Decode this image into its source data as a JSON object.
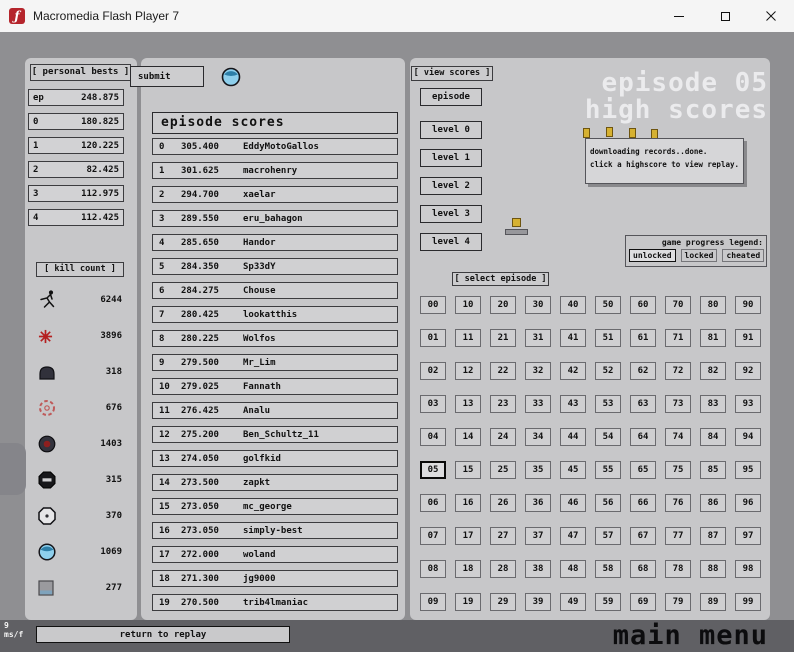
{
  "window": {
    "title": "Macromedia Flash Player 7"
  },
  "personal_bests": {
    "label": "[ personal bests ]",
    "submit_label": "submit",
    "rows": [
      {
        "key": "ep",
        "value": "248.875"
      },
      {
        "key": "0",
        "value": "180.825"
      },
      {
        "key": "1",
        "value": "120.225"
      },
      {
        "key": "2",
        "value": "82.425"
      },
      {
        "key": "3",
        "value": "112.975"
      },
      {
        "key": "4",
        "value": "112.425"
      }
    ]
  },
  "kill_count": {
    "label": "[ kill count ]",
    "rows": [
      {
        "enemy": "ninja",
        "value": "6244"
      },
      {
        "enemy": "mine",
        "value": "3896"
      },
      {
        "enemy": "turret",
        "value": "318"
      },
      {
        "enemy": "rocket-turret",
        "value": "676"
      },
      {
        "enemy": "gauss-turret",
        "value": "1403"
      },
      {
        "enemy": "zap-drone",
        "value": "315"
      },
      {
        "enemy": "seeker-drone",
        "value": "370"
      },
      {
        "enemy": "floatguard",
        "value": "1069"
      },
      {
        "enemy": "thwump",
        "value": "277"
      }
    ]
  },
  "episode_scores": {
    "title": "episode scores",
    "rows": [
      {
        "rank": "0",
        "score": "305.400",
        "name": "EddyMotoGallos"
      },
      {
        "rank": "1",
        "score": "301.625",
        "name": "macrohenry"
      },
      {
        "rank": "2",
        "score": "294.700",
        "name": "xaelar"
      },
      {
        "rank": "3",
        "score": "289.550",
        "name": "eru_bahagon"
      },
      {
        "rank": "4",
        "score": "285.650",
        "name": "Handor"
      },
      {
        "rank": "5",
        "score": "284.350",
        "name": "Sp33dY"
      },
      {
        "rank": "6",
        "score": "284.275",
        "name": "Chouse"
      },
      {
        "rank": "7",
        "score": "280.425",
        "name": "lookatthis"
      },
      {
        "rank": "8",
        "score": "280.225",
        "name": "Wolfos"
      },
      {
        "rank": "9",
        "score": "279.500",
        "name": "Mr_Lim"
      },
      {
        "rank": "10",
        "score": "279.025",
        "name": "Fannath"
      },
      {
        "rank": "11",
        "score": "276.425",
        "name": "Analu"
      },
      {
        "rank": "12",
        "score": "275.200",
        "name": "Ben_Schultz_11"
      },
      {
        "rank": "13",
        "score": "274.050",
        "name": "golfkid"
      },
      {
        "rank": "14",
        "score": "273.500",
        "name": "zapkt"
      },
      {
        "rank": "15",
        "score": "273.050",
        "name": "mc_george"
      },
      {
        "rank": "16",
        "score": "273.050",
        "name": "simply-best"
      },
      {
        "rank": "17",
        "score": "272.000",
        "name": "woland"
      },
      {
        "rank": "18",
        "score": "271.300",
        "name": "jg9000"
      },
      {
        "rank": "19",
        "score": "270.500",
        "name": "trib4lmaniac"
      }
    ]
  },
  "view_scores": {
    "label": "[ view scores ]",
    "buttons": [
      "episode",
      "level 0",
      "level 1",
      "level 2",
      "level 3",
      "level 4"
    ]
  },
  "header": {
    "line1": "episode 05",
    "line2": "high scores"
  },
  "tooltip": {
    "line1": "downloading records..done.",
    "line2": "click a highscore to view replay."
  },
  "legend": {
    "label": "game progress legend:",
    "items": [
      "unlocked",
      "locked",
      "cheated"
    ]
  },
  "select_episode": {
    "label": "[ select episode ]",
    "selected": "05",
    "cells": [
      "00",
      "10",
      "20",
      "30",
      "40",
      "50",
      "60",
      "70",
      "80",
      "90",
      "01",
      "11",
      "21",
      "31",
      "41",
      "51",
      "61",
      "71",
      "81",
      "91",
      "02",
      "12",
      "22",
      "32",
      "42",
      "52",
      "62",
      "72",
      "82",
      "92",
      "03",
      "13",
      "23",
      "33",
      "43",
      "53",
      "63",
      "73",
      "83",
      "93",
      "04",
      "14",
      "24",
      "34",
      "44",
      "54",
      "64",
      "74",
      "84",
      "94",
      "05",
      "15",
      "25",
      "35",
      "45",
      "55",
      "65",
      "75",
      "85",
      "95",
      "06",
      "16",
      "26",
      "36",
      "46",
      "56",
      "66",
      "76",
      "86",
      "96",
      "07",
      "17",
      "27",
      "37",
      "47",
      "57",
      "67",
      "77",
      "87",
      "97",
      "08",
      "18",
      "28",
      "38",
      "48",
      "58",
      "68",
      "78",
      "88",
      "98",
      "09",
      "19",
      "29",
      "39",
      "49",
      "59",
      "69",
      "79",
      "89",
      "99"
    ]
  },
  "footer": {
    "ms_value": "9",
    "ms_label": "ms/f",
    "return_label": "return to replay",
    "main_menu_label": "main menu"
  },
  "colors": {
    "stage_bg": "#8f8f92",
    "panel_bg": "#c7c7c9",
    "gold": "#d6b131",
    "mine_red": "#b51f1f",
    "floatguard_blue": "#8ecfec"
  }
}
